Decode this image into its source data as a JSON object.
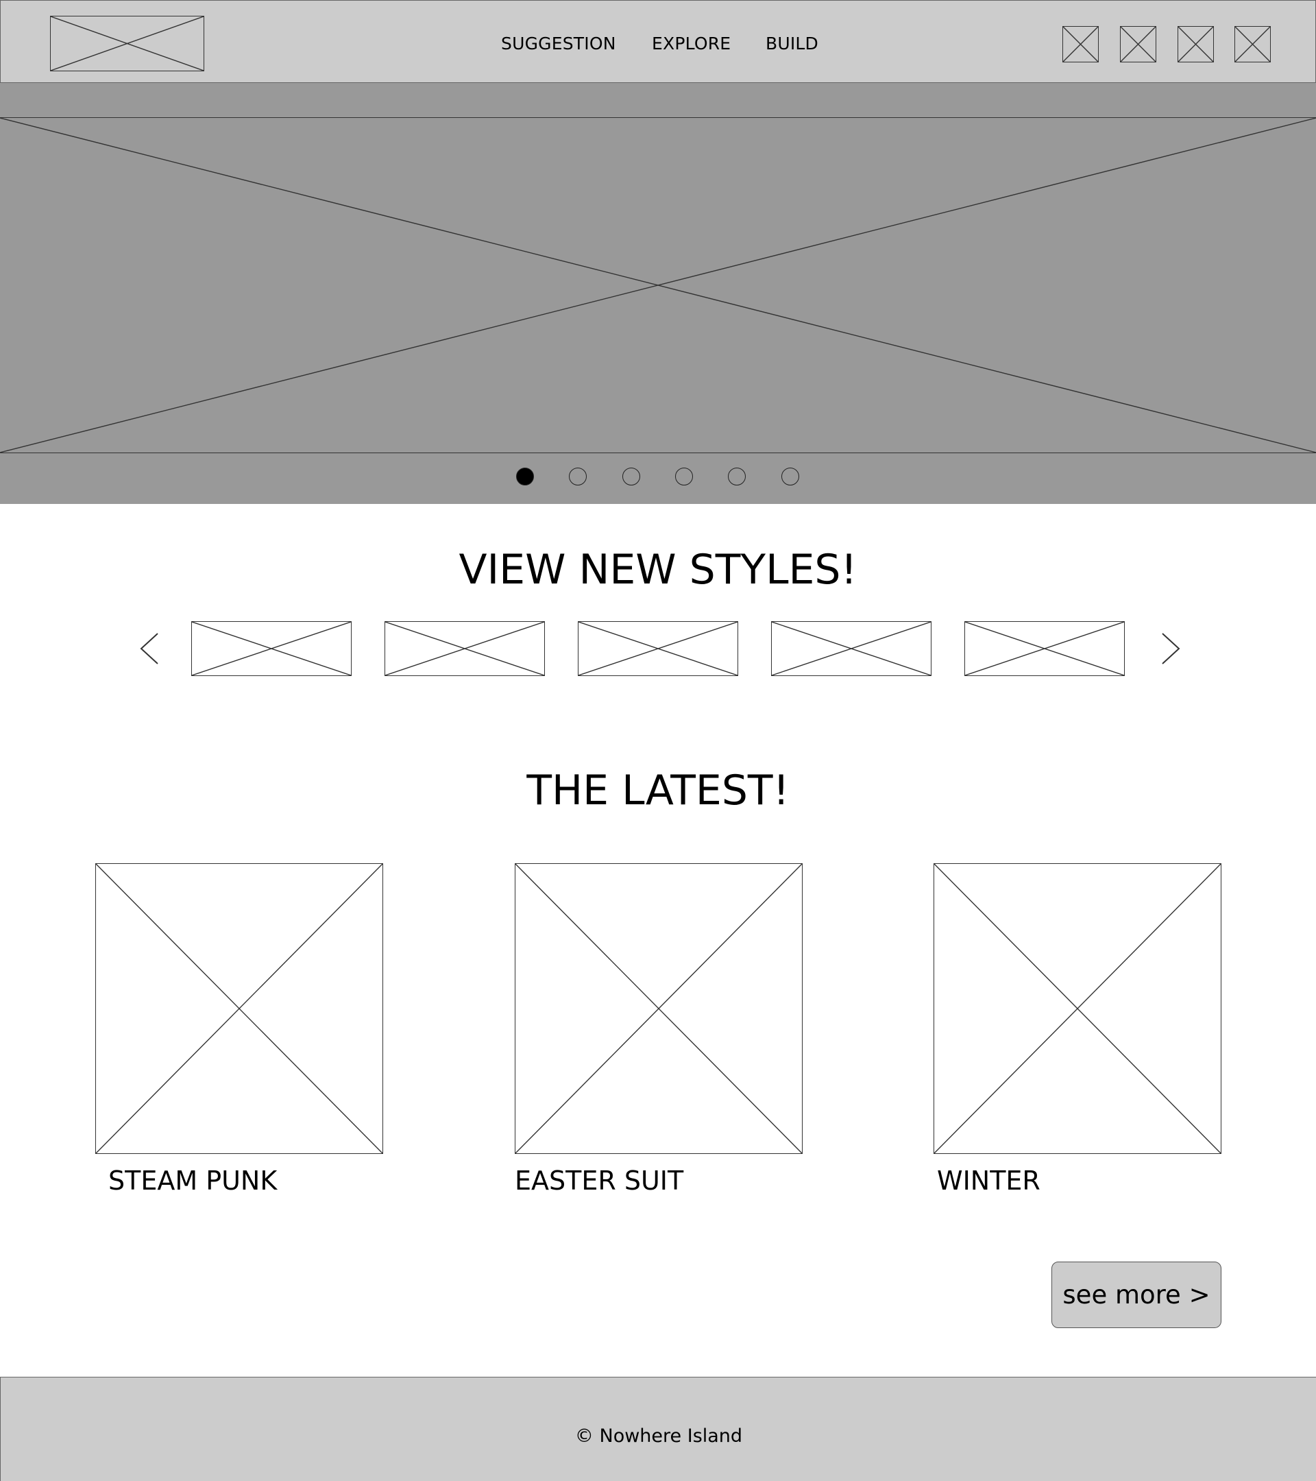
{
  "header": {
    "logo_icon": "image-placeholder-icon",
    "nav": [
      {
        "label": "SUGGESTION"
      },
      {
        "label": "EXPLORE"
      },
      {
        "label": "BUILD"
      }
    ],
    "icons": [
      "image-placeholder-icon",
      "image-placeholder-icon",
      "image-placeholder-icon",
      "image-placeholder-icon"
    ]
  },
  "hero": {
    "image_icon": "image-placeholder-icon",
    "slide_count": 6,
    "active_slide": 1
  },
  "styles": {
    "title": "VIEW NEW STYLES!",
    "prev_icon": "chevron-left-icon",
    "next_icon": "chevron-right-icon",
    "thumbnail_count": 5
  },
  "latest": {
    "title": "THE LATEST!",
    "cards": [
      {
        "label": "STEAM PUNK"
      },
      {
        "label": "EASTER SUIT"
      },
      {
        "label": "WINTER"
      }
    ],
    "see_more_label": "see more >"
  },
  "footer": {
    "text": "© Nowhere Island"
  },
  "colors": {
    "header_bg": "#cccccc",
    "hero_bg": "#999999",
    "footer_bg": "#cccccc",
    "button_bg": "#cccccc"
  }
}
